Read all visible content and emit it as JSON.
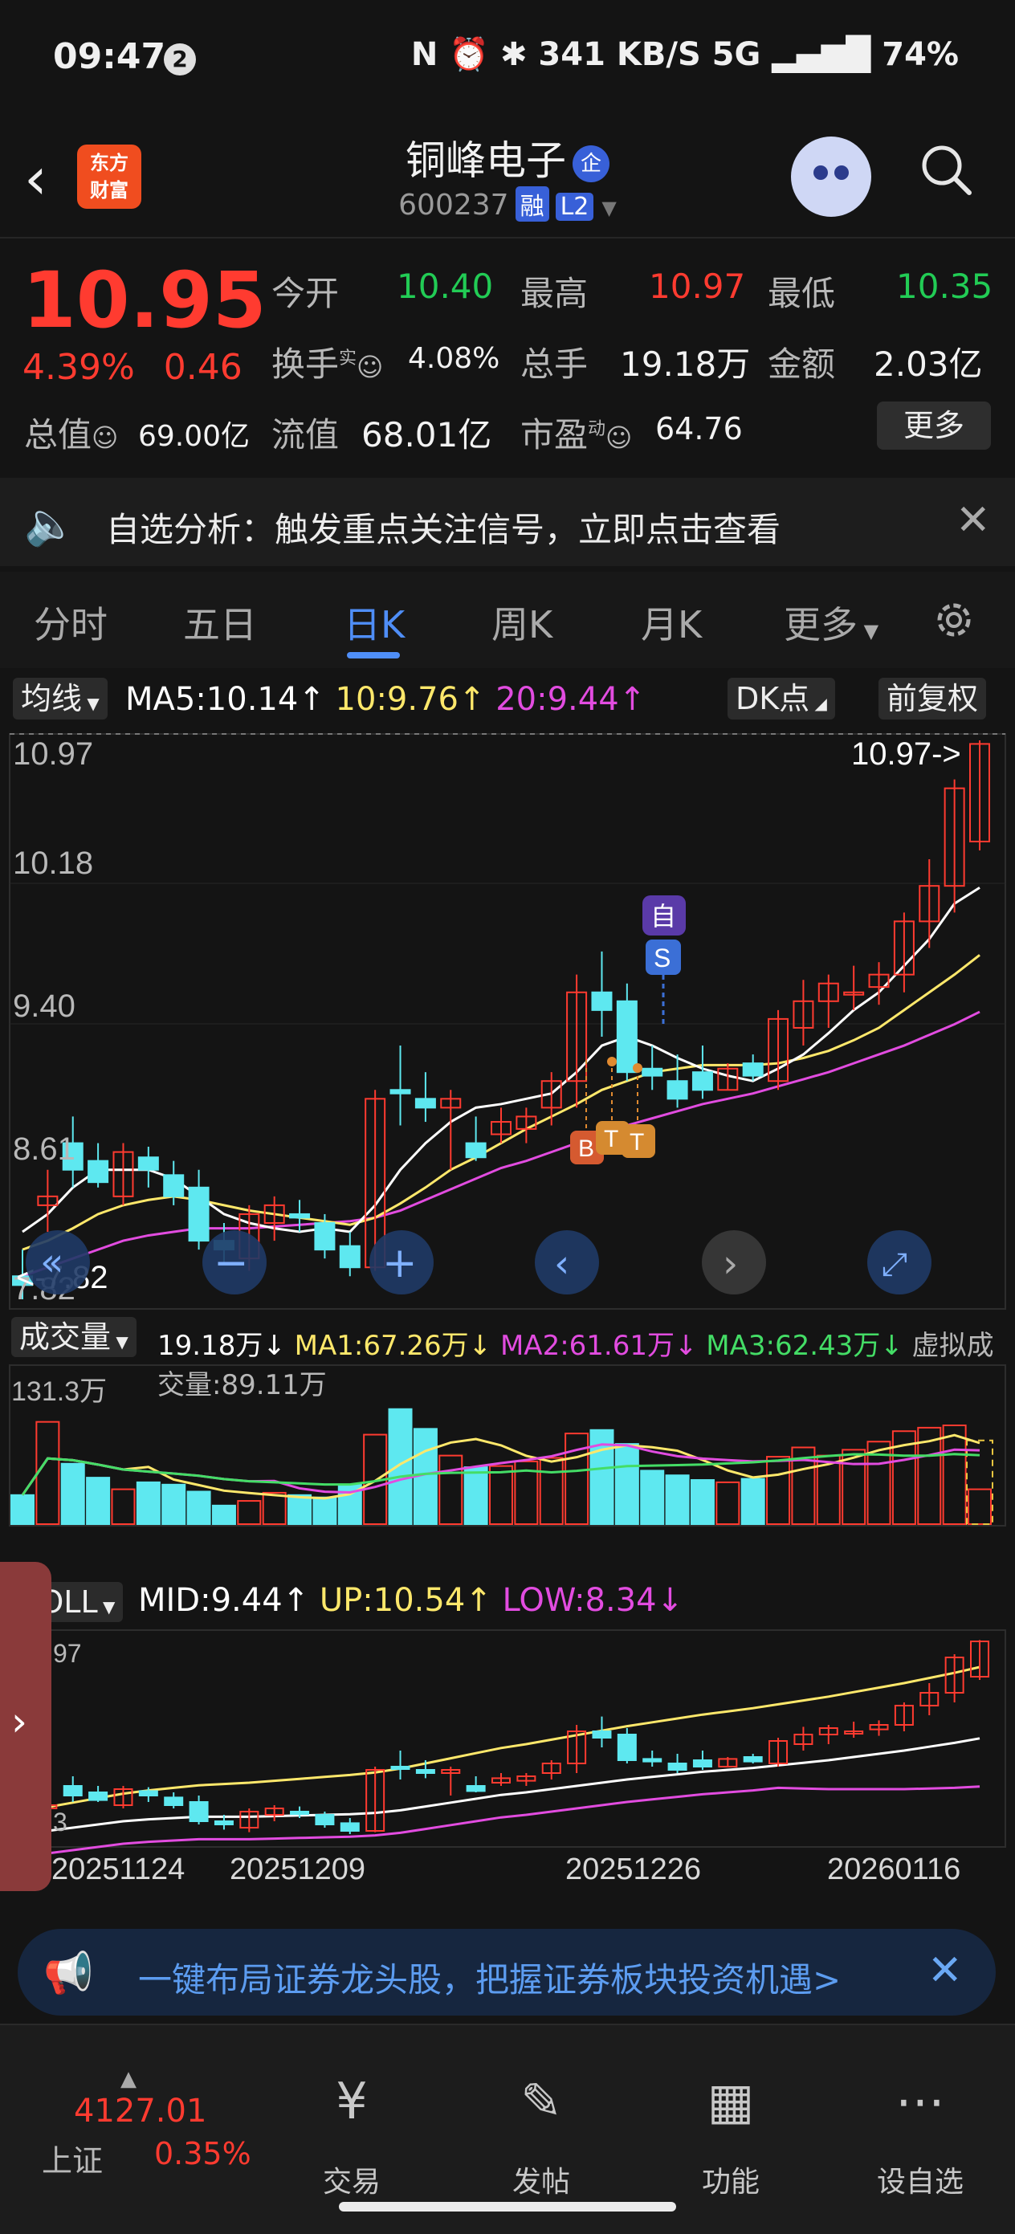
{
  "status": {
    "time": "09:47",
    "badge": "2",
    "right": "N ⏰ ✱ 341 KB/S 5G ▂▄▆█ 74%"
  },
  "header": {
    "back": "‹",
    "logo_line1": "东方",
    "logo_line2": "财富",
    "title": "铜峰电子",
    "ent_tag": "企",
    "code": "600237",
    "tag_rong": "融",
    "tag_l2": "L2"
  },
  "quote": {
    "price": "10.95",
    "pct": "4.39%",
    "chg": "0.46",
    "open_label": "今开",
    "open": "10.40",
    "high_label": "最高",
    "high": "10.97",
    "low_label": "最低",
    "low": "10.35",
    "turnover_label": "换手",
    "turnover_sup": "实",
    "turnover": "4.08%",
    "vol_label": "总手",
    "vol": "19.18万",
    "amount_label": "金额",
    "amount": "2.03亿",
    "mktcap_label": "总值",
    "mktcap": "69.00亿",
    "float_label": "流值",
    "float": "68.01亿",
    "pe_label": "市盈",
    "pe_sup": "动",
    "pe": "64.76",
    "more": "更多"
  },
  "notice": {
    "text": "自选分析：触发重点关注信号，立即点击查看",
    "close": "✕"
  },
  "tabs": [
    "分时",
    "五日",
    "日K",
    "周K",
    "月K",
    "更多"
  ],
  "ma_row": {
    "chip": "均线",
    "ma5": "MA5:10.14↑",
    "ma10": "10:9.76↑",
    "ma20": "20:9.44↑",
    "dk": "DK点",
    "fq": "前复权"
  },
  "vol_row": {
    "chip": "成交量",
    "v": "19.18万↓",
    "ma1": "MA1:67.26万↓",
    "ma2": "MA2:61.61万↓",
    "ma3": "MA3:62.43万↓",
    "virtual": "虚拟成交量:89.11万"
  },
  "boll_row": {
    "chip": "BOLL",
    "mid": "MID:9.44↑",
    "up": "UP:10.54↑",
    "low": "LOW:8.34↓"
  },
  "colors": {
    "up": "#ff3b30",
    "down": "#5ee8f0",
    "ma5": "#ffffff",
    "ma10": "#ffe86b",
    "ma20": "#e24ce0",
    "accent": "#4f8ef7"
  },
  "chart_data": {
    "type": "candlestick",
    "price_axis_labels": [
      "10.97",
      "10.18",
      "9.40",
      "8.61",
      "7.82"
    ],
    "max_label": "10.97->",
    "min_label": "<-7.82",
    "markers": {
      "zi": "自",
      "s": "S",
      "b": "B",
      "t1": "T",
      "t2": "T"
    },
    "x_labels": [
      "20251124",
      "20251209",
      "20251226",
      "20260116"
    ],
    "vol_axis_label": "131.3万",
    "boll_axis_top": "97",
    "boll_axis_bottom": "3",
    "candles": [
      {
        "o": 7.95,
        "h": 8.1,
        "l": 7.82,
        "c": 7.9
      },
      {
        "o": 8.35,
        "h": 8.55,
        "l": 8.2,
        "c": 8.4
      },
      {
        "o": 8.7,
        "h": 8.85,
        "l": 8.45,
        "c": 8.55
      },
      {
        "o": 8.6,
        "h": 8.7,
        "l": 8.45,
        "c": 8.48
      },
      {
        "o": 8.4,
        "h": 8.7,
        "l": 8.35,
        "c": 8.65
      },
      {
        "o": 8.62,
        "h": 8.68,
        "l": 8.45,
        "c": 8.55
      },
      {
        "o": 8.52,
        "h": 8.6,
        "l": 8.35,
        "c": 8.4
      },
      {
        "o": 8.45,
        "h": 8.55,
        "l": 8.1,
        "c": 8.15
      },
      {
        "o": 8.15,
        "h": 8.25,
        "l": 8.02,
        "c": 8.1
      },
      {
        "o": 8.05,
        "h": 8.35,
        "l": 7.98,
        "c": 8.3
      },
      {
        "o": 8.25,
        "h": 8.4,
        "l": 8.15,
        "c": 8.35
      },
      {
        "o": 8.3,
        "h": 8.38,
        "l": 8.2,
        "c": 8.28
      },
      {
        "o": 8.25,
        "h": 8.3,
        "l": 8.05,
        "c": 8.1
      },
      {
        "o": 8.12,
        "h": 8.2,
        "l": 7.95,
        "c": 8.0
      },
      {
        "o": 8.0,
        "h": 9.0,
        "l": 7.98,
        "c": 8.95
      },
      {
        "o": 9.0,
        "h": 9.25,
        "l": 8.8,
        "c": 8.98
      },
      {
        "o": 8.95,
        "h": 9.1,
        "l": 8.82,
        "c": 8.9
      },
      {
        "o": 8.9,
        "h": 9.0,
        "l": 8.55,
        "c": 8.95
      },
      {
        "o": 8.7,
        "h": 8.85,
        "l": 8.6,
        "c": 8.62
      },
      {
        "o": 8.75,
        "h": 8.9,
        "l": 8.7,
        "c": 8.82
      },
      {
        "o": 8.78,
        "h": 8.9,
        "l": 8.7,
        "c": 8.85
      },
      {
        "o": 8.9,
        "h": 9.1,
        "l": 8.8,
        "c": 9.05
      },
      {
        "o": 9.05,
        "h": 9.65,
        "l": 8.9,
        "c": 9.55
      },
      {
        "o": 9.55,
        "h": 9.78,
        "l": 9.3,
        "c": 9.45
      },
      {
        "o": 9.5,
        "h": 9.6,
        "l": 9.05,
        "c": 9.1
      },
      {
        "o": 9.12,
        "h": 9.25,
        "l": 9.0,
        "c": 9.08
      },
      {
        "o": 9.05,
        "h": 9.2,
        "l": 8.9,
        "c": 8.95
      },
      {
        "o": 9.1,
        "h": 9.25,
        "l": 8.95,
        "c": 9.0
      },
      {
        "o": 9.0,
        "h": 9.15,
        "l": 9.0,
        "c": 9.12
      },
      {
        "o": 9.15,
        "h": 9.2,
        "l": 9.05,
        "c": 9.08
      },
      {
        "o": 9.05,
        "h": 9.45,
        "l": 9.0,
        "c": 9.4
      },
      {
        "o": 9.35,
        "h": 9.62,
        "l": 9.25,
        "c": 9.5
      },
      {
        "o": 9.5,
        "h": 9.65,
        "l": 9.35,
        "c": 9.6
      },
      {
        "o": 9.55,
        "h": 9.7,
        "l": 9.45,
        "c": 9.55
      },
      {
        "o": 9.58,
        "h": 9.72,
        "l": 9.48,
        "c": 9.65
      },
      {
        "o": 9.65,
        "h": 10.0,
        "l": 9.55,
        "c": 9.95
      },
      {
        "o": 9.95,
        "h": 10.3,
        "l": 9.8,
        "c": 10.15
      },
      {
        "o": 10.15,
        "h": 10.75,
        "l": 10.0,
        "c": 10.7
      },
      {
        "o": 10.4,
        "h": 10.97,
        "l": 10.35,
        "c": 10.95
      }
    ],
    "volume": [
      2.5,
      8.8,
      5.2,
      4.0,
      3.0,
      3.6,
      3.4,
      2.8,
      1.6,
      2.0,
      2.7,
      2.5,
      2.3,
      3.4,
      7.7,
      9.9,
      8.2,
      5.9,
      4.9,
      5.0,
      5.4,
      5.7,
      7.8,
      8.1,
      6.9,
      4.6,
      4.2,
      3.8,
      3.6,
      3.9,
      5.8,
      6.6,
      5.9,
      6.4,
      7.1,
      8.0,
      8.3,
      8.5,
      3.0
    ],
    "ma5": [
      8.2,
      8.3,
      8.45,
      8.55,
      8.55,
      8.55,
      8.5,
      8.4,
      8.3,
      8.25,
      8.22,
      8.2,
      8.22,
      8.2,
      8.35,
      8.55,
      8.7,
      8.82,
      8.9,
      8.92,
      8.95,
      8.98,
      9.1,
      9.25,
      9.3,
      9.25,
      9.18,
      9.12,
      9.08,
      9.05,
      9.12,
      9.2,
      9.32,
      9.45,
      9.55,
      9.7,
      9.85,
      10.05,
      10.14
    ],
    "ma10": [
      8.1,
      8.15,
      8.22,
      8.3,
      8.35,
      8.38,
      8.4,
      8.38,
      8.35,
      8.32,
      8.3,
      8.28,
      8.26,
      8.24,
      8.28,
      8.36,
      8.45,
      8.55,
      8.62,
      8.7,
      8.78,
      8.85,
      8.92,
      9.0,
      9.05,
      9.1,
      9.12,
      9.14,
      9.14,
      9.14,
      9.15,
      9.18,
      9.22,
      9.28,
      9.35,
      9.45,
      9.55,
      9.65,
      9.76
    ],
    "ma20": [
      7.95,
      8.0,
      8.05,
      8.1,
      8.15,
      8.18,
      8.2,
      8.22,
      8.22,
      8.22,
      8.23,
      8.24,
      8.25,
      8.26,
      8.28,
      8.32,
      8.38,
      8.44,
      8.5,
      8.56,
      8.6,
      8.65,
      8.7,
      8.75,
      8.8,
      8.84,
      8.88,
      8.92,
      8.95,
      8.98,
      9.02,
      9.06,
      9.1,
      9.15,
      9.2,
      9.25,
      9.31,
      9.37,
      9.44
    ]
  },
  "ad": {
    "text": "一键布局证券龙头股，把握证券板块投资机遇>",
    "close": "✕"
  },
  "bottom": {
    "index_value": "4127.01",
    "index_name": "上证",
    "index_pct": "0.35%",
    "nav": [
      "交易",
      "发帖",
      "功能",
      "设自选"
    ]
  }
}
